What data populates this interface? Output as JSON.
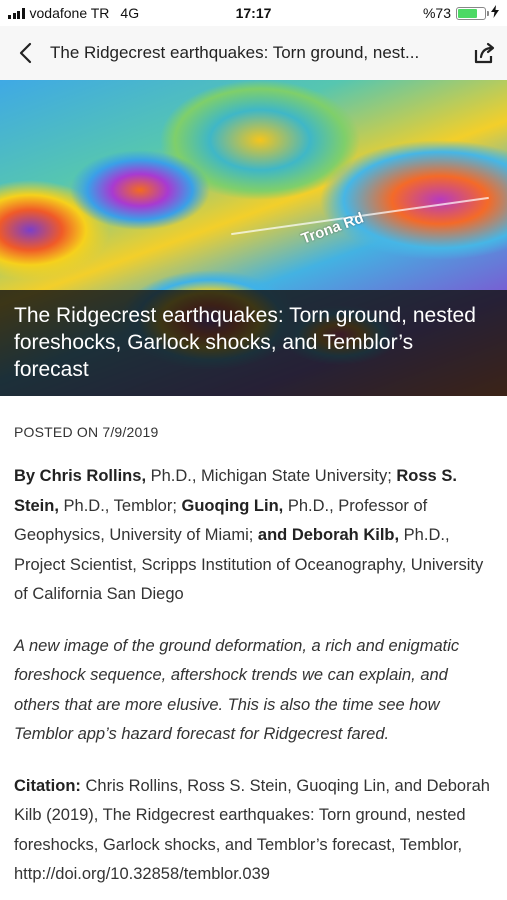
{
  "status": {
    "carrier": "vodafone TR",
    "network": "4G",
    "time": "17:17",
    "battery_text": "%73",
    "battery_level": 0.73
  },
  "nav": {
    "title": "The Ridgecrest earthquakes: Torn ground, nest..."
  },
  "hero": {
    "map_label": "Trona Rd",
    "caption": "The Ridgecrest earthquakes: Torn ground, nested foreshocks, Garlock shocks, and Temblor’s forecast"
  },
  "article": {
    "posted": "POSTED ON 7/9/2019",
    "byline": {
      "prefix": "By Chris Rollins,",
      "a1_aff": " Ph.D., Michigan State University; ",
      "a2": "Ross S. Stein,",
      "a2_aff": " Ph.D., Temblor; ",
      "a3": "Guoqing Lin,",
      "a3_aff": " Ph.D., Professor of Geophysics, University of Miami; ",
      "a4": "and Deborah Kilb,",
      "a4_aff": " Ph.D., Project Scientist, Scripps Institution of Oceanography, University of California San Diego"
    },
    "lead": "A new image of the ground deformation, a rich and enigmatic foreshock sequence, aftershock trends we can explain, and others that are more elusive. This is also the time see how Temblor app’s hazard forecast for Ridgecrest fared.",
    "citation": {
      "label": "Citation:",
      "text": " Chris Rollins, Ross S. Stein, Guoqing Lin, and Deborah Kilb (2019), The Ridgecrest earthquakes: Torn ground, nested foreshocks, Garlock shocks, and Temblor’s forecast, Temblor, http://doi.org/10.32858/temblor.039"
    }
  }
}
